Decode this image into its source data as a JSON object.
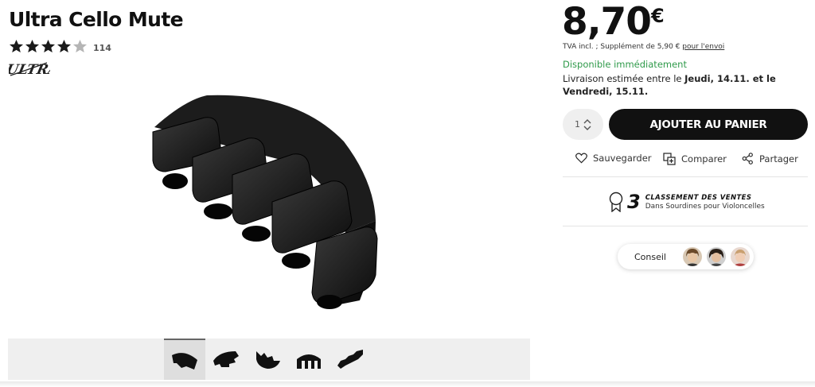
{
  "product": {
    "title": "Ultra Cello Mute",
    "rating_value": 4,
    "rating_max": 5,
    "rating_count": "114",
    "brand_logo_text": "ULTRA"
  },
  "pricing": {
    "price": "8,70",
    "currency": "€",
    "tax_note": "TVA incl. ; Supplément de 5,90 € ",
    "shipping_link": "pour l'envoi"
  },
  "availability": "Disponible immédiatement",
  "delivery": {
    "prefix": "Livraison estimée entre le ",
    "date_from": "Jeudi, 14.11.",
    "middle": " et le ",
    "date_to": "Vendredi, 15.11."
  },
  "cart": {
    "quantity": "1",
    "add_to_cart_label": "AJOUTER AU PANIER"
  },
  "actions": {
    "save": "Sauvegarder",
    "compare": "Comparer",
    "share": "Partager"
  },
  "ranking": {
    "position": "3",
    "label": "CLASSEMENT DES VENTES",
    "category": "Dans Sourdines pour Violoncelles"
  },
  "advice": {
    "label": "Conseil"
  },
  "gallery": {
    "thumbnail_count": 5,
    "active_index": 0
  }
}
